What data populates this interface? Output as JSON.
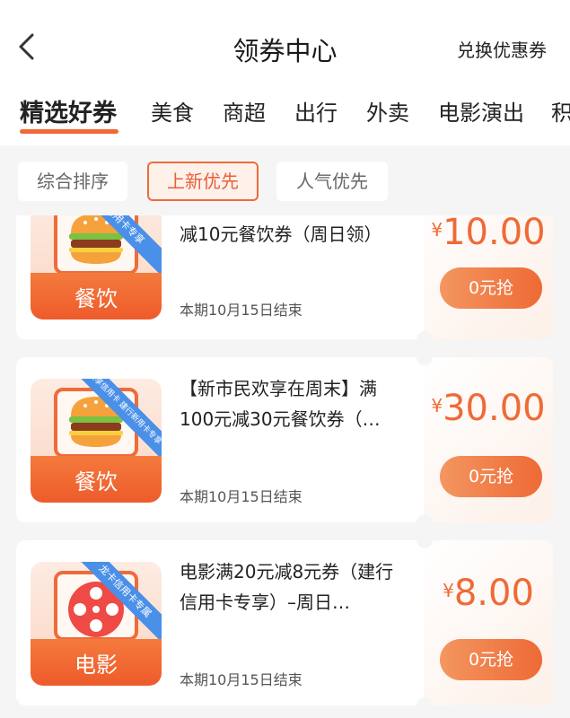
{
  "header": {
    "title": "领券中心",
    "exchange_label": "兑换优惠券"
  },
  "tabs": [
    {
      "label": "精选好券",
      "active": true
    },
    {
      "label": "美食"
    },
    {
      "label": "商超"
    },
    {
      "label": "出行"
    },
    {
      "label": "外卖"
    },
    {
      "label": "电影演出"
    },
    {
      "label": "积"
    }
  ],
  "filters": [
    {
      "label": "综合排序"
    },
    {
      "label": "上新优先",
      "active": true
    },
    {
      "label": "人气优先"
    }
  ],
  "coupons": [
    {
      "category": "餐饮",
      "icon": "burger-icon",
      "ribbon": "信用卡专享",
      "title": "减10元餐饮券（周日领）",
      "end_date": "本期10月15日结束",
      "currency": "¥",
      "amount": "10.00",
      "button": "0元抢"
    },
    {
      "category": "餐饮",
      "icon": "burger-icon",
      "ribbon": "欢享信用卡 建行新用卡专享",
      "title": "【新市民欢享在周末】满100元减30元餐饮券（…",
      "end_date": "本期10月15日结束",
      "currency": "¥",
      "amount": "30.00",
      "button": "0元抢"
    },
    {
      "category": "电影",
      "icon": "film-reel-icon",
      "ribbon": "龙卡信用卡专属",
      "title": "电影满20元减8元券（建行信用卡专享）–周日…",
      "end_date": "本期10月15日结束",
      "currency": "¥",
      "amount": "8.00",
      "button": "0元抢"
    }
  ],
  "colors": {
    "accent": "#EE6A35",
    "ribbon": "#4A90E8",
    "background": "#F5F5F5"
  }
}
